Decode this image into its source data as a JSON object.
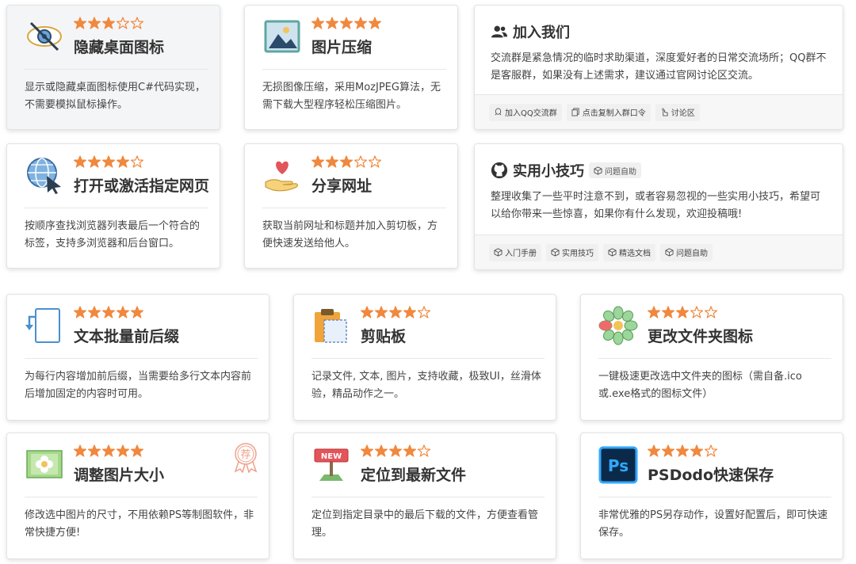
{
  "colors": {
    "star": "#f0883e",
    "star_empty": "#f0883e",
    "text": "#333333"
  },
  "cards_top": [
    {
      "title": "隐藏桌面图标",
      "rating": 3,
      "icon": "eye-slash-icon",
      "desc": "显示或隐藏桌面图标使用C#代码实现，不需要模拟鼠标操作。"
    },
    {
      "title": "图片压缩",
      "rating": 5,
      "icon": "image-icon",
      "desc": "无损图像压缩，采用MozJPEG算法，无需下载大型程序轻松压缩图片。"
    },
    {
      "title": "打开或激活指定网页",
      "rating": 4,
      "icon": "globe-cursor-icon",
      "desc": "按顺序查找浏览器列表最后一个符合的标签，支持多浏览器和后台窗口。"
    },
    {
      "title": "分享网址",
      "rating": 3,
      "icon": "heart-hand-icon",
      "desc": "获取当前网址和标题并加入剪切板，方便快速发送给他人。"
    }
  ],
  "join": {
    "title": "加入我们",
    "desc": "交流群是紧急情况的临时求助渠道，深度爱好者的日常交流场所；QQ群不是客服群，如果没有上述需求，建议通过官网讨论区交流。",
    "buttons": [
      "加入QQ交流群",
      "点击复制入群口令",
      "讨论区"
    ]
  },
  "tips": {
    "title": "实用小技巧",
    "tag": "问题自助",
    "desc": "整理收集了一些平时注意不到，或者容易忽视的一些实用小技巧，希望可以给你带来一些惊喜，如果你有什么发现，欢迎投稿哦!",
    "buttons": [
      "入门手册",
      "实用技巧",
      "精选文档",
      "问题自助"
    ]
  },
  "cards_bottom": [
    {
      "title": "文本批量前后缀",
      "rating": 5,
      "icon": "document-arrow-icon",
      "desc": "为每行内容增加前后缀，当需要给多行文本内容前后增加固定的内容时可用。"
    },
    {
      "title": "剪贴板",
      "rating": 4,
      "icon": "clipboard-icon",
      "desc": "记录文件, 文本, 图片，支持收藏，极致UI，丝滑体验，精品动作之一。"
    },
    {
      "title": "更改文件夹图标",
      "rating": 3,
      "icon": "flower-icon",
      "desc": "一键极速更改选中文件夹的图标（需自备.ico或.exe格式的图标文件）"
    },
    {
      "title": "调整图片大小",
      "rating": 5,
      "icon": "picture-flower-icon",
      "desc": "修改选中图片的尺寸，不用依赖PS等制图软件，非常快捷方便!",
      "badge": "荐"
    },
    {
      "title": "定位到最新文件",
      "rating": 4,
      "icon": "new-sign-icon",
      "desc": "定位到指定目录中的最后下载的文件，方便查看管理。"
    },
    {
      "title": "PSDodo快速保存",
      "rating": 4,
      "icon": "photoshop-icon",
      "desc": "非常优雅的PS另存动作，设置好配置后，即可快速保存。"
    }
  ]
}
